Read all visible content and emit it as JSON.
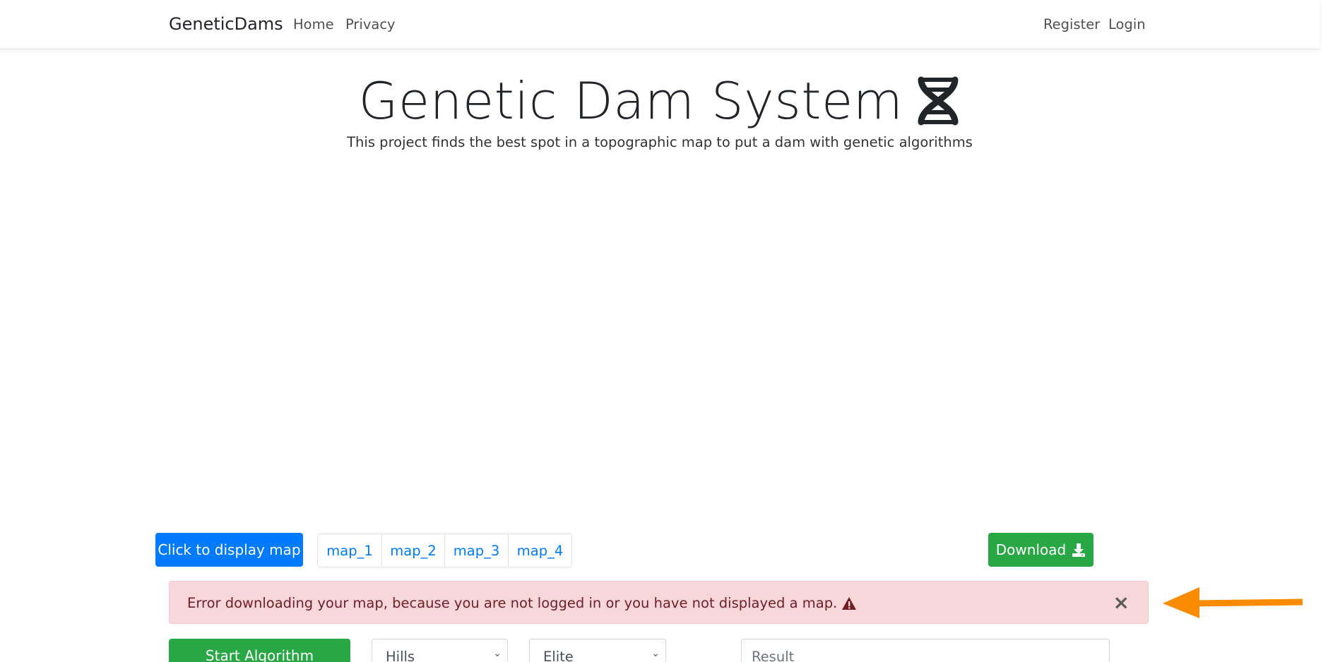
{
  "nav": {
    "brand": "GeneticDams",
    "home": "Home",
    "privacy": "Privacy",
    "register": "Register",
    "login": "Login"
  },
  "hero": {
    "title": "Genetic Dam System",
    "subtitle": "This project finds the best spot in a topographic map to put a dam with genetic algorithms",
    "icon": "dna-icon"
  },
  "controls": {
    "display_map_label": "Click to display map",
    "maps": [
      "map_1",
      "map_2",
      "map_3",
      "map_4"
    ],
    "download_label": "Download",
    "download_icon": "download-icon"
  },
  "alert": {
    "message": "Error downloading your map, because you are not logged in or you have not displayed a map.",
    "icon": "warning-icon",
    "close": "×"
  },
  "algorithm": {
    "start_label": "Start Algorithm",
    "terrain_selected": "Hills",
    "selection_selected": "Elite",
    "result_placeholder": "Result"
  },
  "colors": {
    "primary": "#007bff",
    "success": "#28a745",
    "danger_bg": "#f8d7da",
    "danger_text": "#721c24",
    "annotation_arrow": "#fb8c00"
  }
}
